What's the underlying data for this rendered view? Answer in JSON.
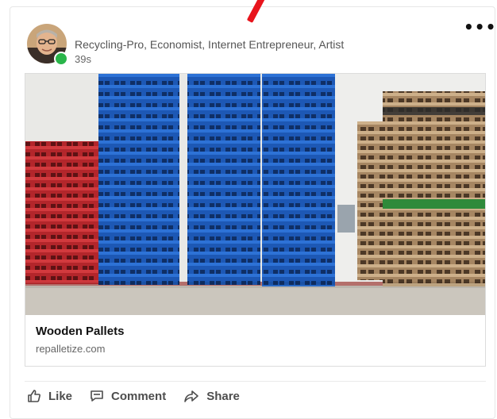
{
  "post": {
    "author_headline": "Recycling-Pro, Economist, Internet Entrepreneur, Artist",
    "timestamp": "39s",
    "more_label": "•••"
  },
  "link_preview": {
    "title": "Wooden Pallets",
    "domain": "repalletize.com"
  },
  "actions": {
    "like": "Like",
    "comment": "Comment",
    "share": "Share"
  },
  "colors": {
    "presence": "#2ab54a",
    "annotation_arrow": "#e8141c",
    "pallet_blue": "#1f5fbf",
    "pallet_red": "#b8262b",
    "pallet_green": "#2f8a3a"
  }
}
